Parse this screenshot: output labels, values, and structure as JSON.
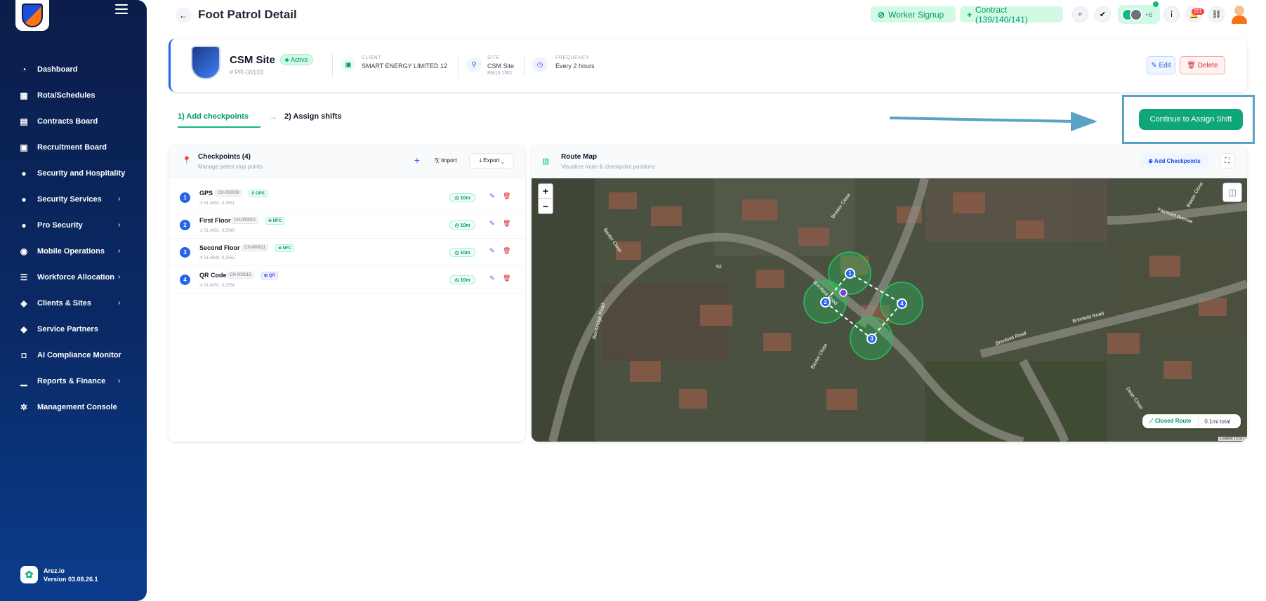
{
  "window": {
    "title": "Foot Patrol Detail"
  },
  "header": {
    "worker_signup": "Worker Signup",
    "contract": "Contract (139/140/141)",
    "avatars_more": "+6",
    "notification_count": "221"
  },
  "sidebar": {
    "items": [
      {
        "label": "Dashboard",
        "icon": "dashboard-icon",
        "has_submenu": false
      },
      {
        "label": "Rota/Schedules",
        "icon": "calendar-icon",
        "has_submenu": false
      },
      {
        "label": "Contracts Board",
        "icon": "contracts-icon",
        "has_submenu": false
      },
      {
        "label": "Recruitment Board",
        "icon": "recruitment-icon",
        "has_submenu": false
      },
      {
        "label": "Security and Hospitality",
        "icon": "user-icon",
        "has_submenu": true
      },
      {
        "label": "Security Services",
        "icon": "user-icon",
        "has_submenu": true
      },
      {
        "label": "Pro Security",
        "icon": "user-icon",
        "has_submenu": true
      },
      {
        "label": "Mobile Operations",
        "icon": "car-icon",
        "has_submenu": true
      },
      {
        "label": "Workforce Allocation",
        "icon": "list-icon",
        "has_submenu": true
      },
      {
        "label": "Clients & Sites",
        "icon": "clients-icon",
        "has_submenu": true
      },
      {
        "label": "Service Partners",
        "icon": "handshake-icon",
        "has_submenu": false
      },
      {
        "label": "AI Compliance Monitor",
        "icon": "robot-icon",
        "has_submenu": true
      },
      {
        "label": "Reports & Finance",
        "icon": "chart-icon",
        "has_submenu": true
      },
      {
        "label": "Management Console",
        "icon": "gears-icon",
        "has_submenu": false
      }
    ],
    "brand_name": "Arez.io",
    "version": "Version 03.08.26.1"
  },
  "site": {
    "name": "CSM Site",
    "status": "Active",
    "id": "# PR-00133",
    "client_label": "CLIENT",
    "client_value": "SMART ENERGY LIMITED 12",
    "site_label": "SITE",
    "site_value": "CSM Site",
    "site_postcode": "RM19 1RG",
    "frequency_label": "FREQUENCY",
    "frequency_value": "Every 2 hours",
    "edit_label": "✎ Edit",
    "delete_label": "🗑 Delete"
  },
  "steps": {
    "step1": "1) Add checkpoints",
    "step2": "2) Assign shifts",
    "continue_label": "Continue to Assign Shift"
  },
  "checkpoints": {
    "title": "Checkpoints (4)",
    "subtitle": "Manage patrol stop points",
    "import_label": "⎘ Import",
    "export_label": "⤓ Export ⌄",
    "items": [
      {
        "num": "1",
        "name": "GPS",
        "code": "CH-000009",
        "type": "⚲ GPS",
        "coords": "⊙ 51.4852, 0.2551",
        "time": "◷ 10m"
      },
      {
        "num": "2",
        "name": "First Floor",
        "code": "CH-000010",
        "type": "≋ NFC",
        "coords": "⊙ 51.4851, 0.2549",
        "time": "◷ 10m"
      },
      {
        "num": "3",
        "name": "Second Floor",
        "code": "CH-000011",
        "type": "≋ NFC",
        "coords": "⊙ 51.4849, 0.2552",
        "time": "◷ 10m"
      },
      {
        "num": "4",
        "name": "QR Code",
        "code": "CH-000012",
        "type": "⊞ QR",
        "coords": "⊙ 51.4851, 0.2554",
        "time": "◷ 10m"
      }
    ]
  },
  "map": {
    "title": "Route Map",
    "subtitle": "Visualize route & checkpoint positions",
    "add_checkpoints": "⊕ Add Checkpoints",
    "route_type": "⟋ Closed Route",
    "route_distance": "0.1mi total",
    "attribution": "Leaflet | Esri",
    "street_labels": [
      "Brewer Close",
      "Fairmont Avenue",
      "Baxter Close",
      "Brimfield Road",
      "Brimfield Road",
      "Baxter Close",
      "Bembridge Road",
      "Brimfield Road",
      "Dean Close",
      "Baxter Close",
      "52"
    ],
    "markers": [
      "1",
      "2",
      "3",
      "4"
    ]
  },
  "colors": {
    "accent": "#10b981",
    "primary": "#2563eb",
    "danger": "#dc2626",
    "sidebar_bg": "#0a2a66",
    "annotation": "#5ba3c4"
  }
}
